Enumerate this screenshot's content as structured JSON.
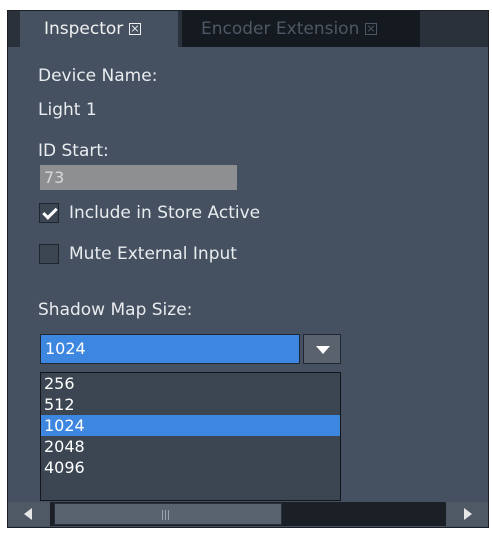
{
  "tabs": [
    {
      "label": "Inspector",
      "active": true,
      "close_icon": "close-box-icon"
    },
    {
      "label": "Encoder Extension",
      "active": false,
      "close_icon": "close-box-icon"
    }
  ],
  "inspector": {
    "device_name_label": "Device Name:",
    "device_name_value": "Light 1",
    "id_start_label": "ID Start:",
    "id_start_value": "73",
    "include_store_active": {
      "label": "Include in Store Active",
      "checked": true
    },
    "mute_external_input": {
      "label": "Mute External Input",
      "checked": false
    },
    "shadow_map_size_label": "Shadow Map Size:",
    "shadow_map_size_selected": "1024",
    "shadow_map_size_options": [
      "256",
      "512",
      "1024",
      "2048",
      "4096"
    ]
  },
  "colors": {
    "panel_bg": "#455160",
    "accent": "#3d87e1",
    "tab_inactive_bg": "#151920",
    "input_bg": "#8e8f91"
  }
}
